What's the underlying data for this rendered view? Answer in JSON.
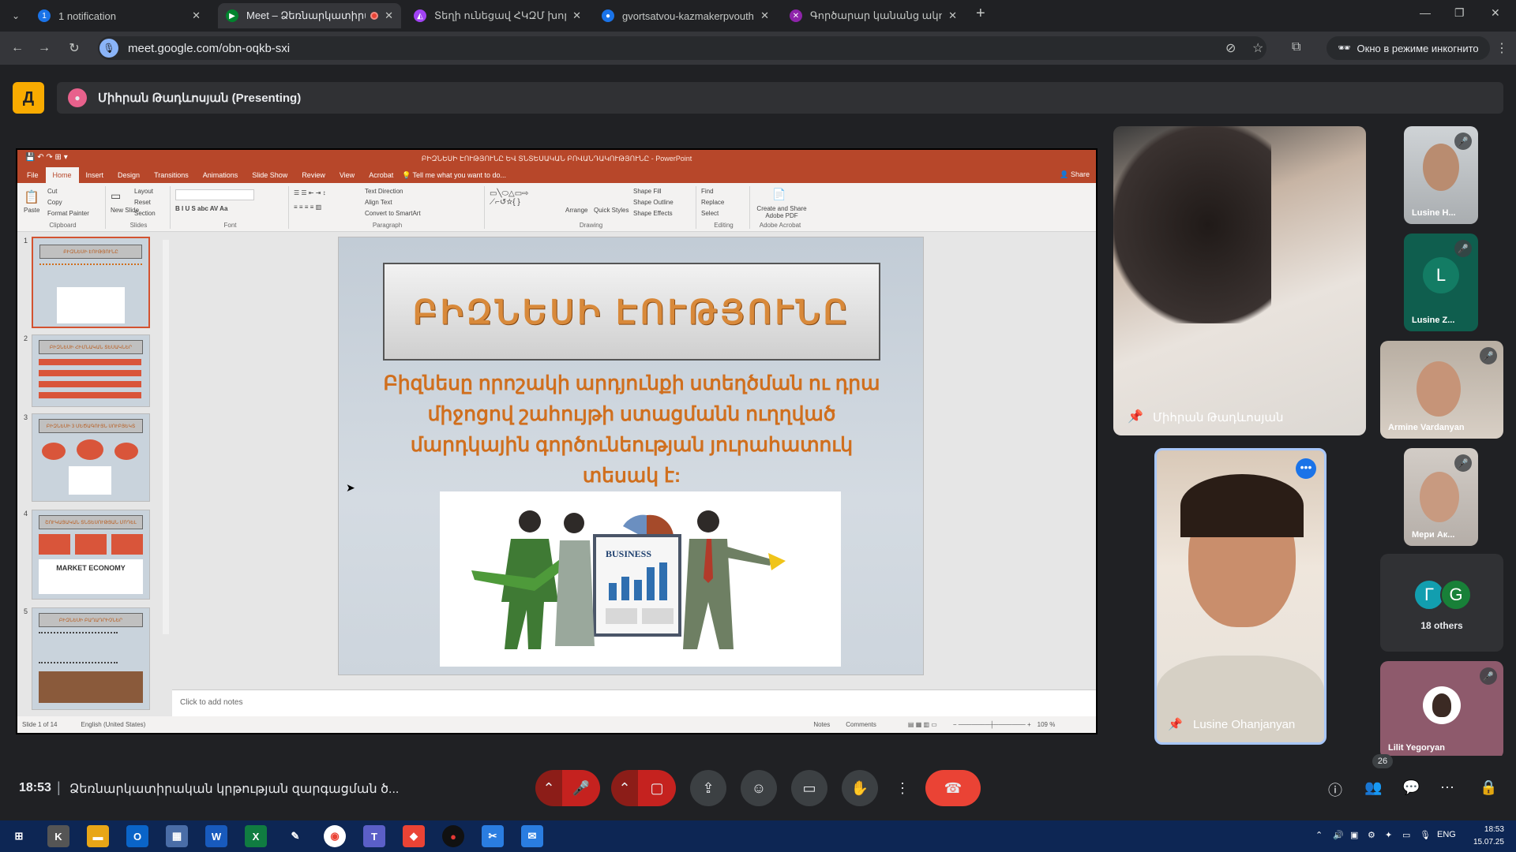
{
  "browser": {
    "tabs": [
      {
        "title": "1 notification",
        "favicon": "notification-icon",
        "color": "#1a73e8"
      },
      {
        "title": "Meet – Ձեռնարկատիրակ",
        "favicon": "meet-icon",
        "color": "#00832d",
        "active": true
      },
      {
        "title": "Տեղի ունեցավ ՀԿԶՄ խորհրդ",
        "favicon": "doc-icon",
        "color": "#a142f4"
      },
      {
        "title": "gvortsatvou-kazmakerpvouthy",
        "favicon": "link-icon",
        "color": "#1a73e8"
      },
      {
        "title": "Գործարար կանանց ակումբ",
        "favicon": "x-icon",
        "color": "#8e24aa"
      }
    ],
    "url": "meet.google.com/obn-oqkb-sxi",
    "incognito_label": "Окно в режиме инкогнито"
  },
  "meet": {
    "presenting_label": "Միհրան Թադևոսյան (Presenting)",
    "time": "18:53",
    "meeting_title": "Ձեռնարկատիրական կրթության զարգացման ծ...",
    "participants_count": "26",
    "others_label": "18 others",
    "others_initials": [
      "Г",
      "G"
    ]
  },
  "participants": {
    "pinned_main": "Միհրան Թադևոսյան",
    "speaker": "Lusine Ohanjanyan",
    "side": [
      {
        "name": "Lusine H...",
        "muted": true
      },
      {
        "name": "Lusine Z...",
        "initial": "L",
        "muted": true
      },
      {
        "name": "Armine Vardanyan",
        "muted": true
      },
      {
        "name": "Мери Ак...",
        "muted": true
      },
      {
        "name": "Lilit Yegoryan",
        "muted": true
      }
    ]
  },
  "powerpoint": {
    "window_title": "ԲԻԶՆԵՍԻ ԷՈՒԹՅՈՒՆԸ ԵՎ ՏՆՏԵՍԱԿԱՆ ԲՈՎԱՆԴԱԿՈՒԹՅՈՒՆԸ - PowerPoint",
    "tabs": [
      "File",
      "Home",
      "Insert",
      "Design",
      "Transitions",
      "Animations",
      "Slide Show",
      "Review",
      "View",
      "Acrobat"
    ],
    "tell_me": "Tell me what you want to do...",
    "share": "Share",
    "groups": [
      "Clipboard",
      "Slides",
      "Font",
      "Paragraph",
      "Drawing",
      "Editing",
      "Adobe Acrobat"
    ],
    "ribbon": {
      "paste": "Paste",
      "cut": "Cut",
      "copy": "Copy",
      "format_painter": "Format Painter",
      "new_slide": "New Slide",
      "layout": "Layout",
      "reset": "Reset",
      "section": "Section",
      "text_direction": "Text Direction",
      "align_text": "Align Text",
      "convert_smartart": "Convert to SmartArt",
      "arrange": "Arrange",
      "quick_styles": "Quick Styles",
      "shape_fill": "Shape Fill",
      "shape_outline": "Shape Outline",
      "shape_effects": "Shape Effects",
      "find": "Find",
      "replace": "Replace",
      "select": "Select",
      "create_pdf": "Create and Share Adobe PDF"
    },
    "slide": {
      "title": "ԲԻԶՆԵՍԻ ԷՈՒԹՅՈՒՆԸ",
      "body": "Բիզնեսը որոշակի արդյունքի ստեղծման ու դրա միջոցով շահույթի ստացմանն ուղղված մարդկային գործունեության յուրահատուկ տեսակ է:",
      "image_label": "BUSINESS"
    },
    "thumbnails": [
      {
        "num": "1",
        "title": "ԲԻԶՆԵՍԻ ԷՈՒԹՅՈՒՆԸ"
      },
      {
        "num": "2",
        "title": "ԲԻԶՆԵՍԻ ՀԻՄՆԱԿԱՆ ՏԵՍԱԿՆԵՐ"
      },
      {
        "num": "3",
        "title": "ԲԻԶՆԵՍԻ 3 ՄԵԾԱԳՈՒՅՆ ՍՈՒԲՅԵԿՏ"
      },
      {
        "num": "4",
        "title": "ՇՈՒԿԱՅԱԿԱՆ ՏՆՏԵՍՈՒԹՅԱՆ ՄՈԴԵԼ",
        "extra": "MARKET ECONOMY"
      },
      {
        "num": "5",
        "title": "ԲԻԶՆԵՍԻ ԲԱՂԱԴՐԻՉՆԵՐ"
      }
    ],
    "notes_placeholder": "Click to add notes",
    "status": {
      "slide": "Slide 1 of 14",
      "lang": "English (United States)",
      "notes": "Notes",
      "comments": "Comments",
      "zoom": "109 %"
    }
  },
  "taskbar": {
    "lang": "ENG",
    "time": "18:53",
    "date": "15.07.25"
  }
}
